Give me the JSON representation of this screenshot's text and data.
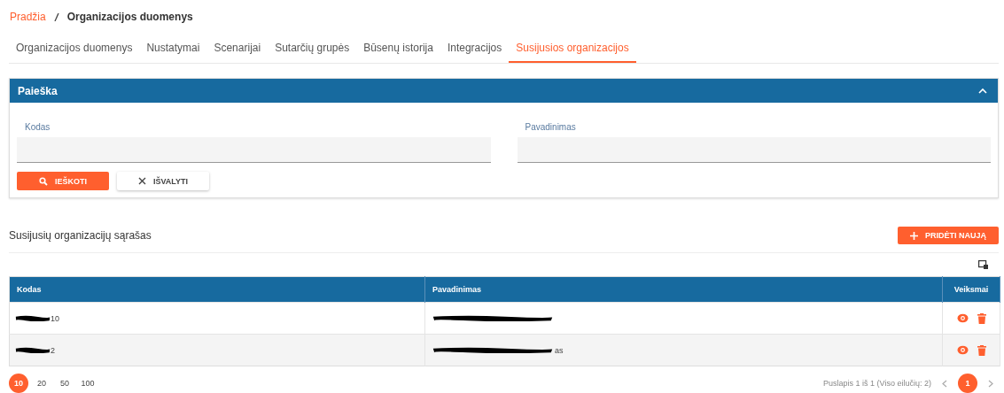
{
  "breadcrumb": [
    {
      "label": "Pradžia",
      "kind": "link"
    },
    {
      "label": "Organizacijos duomenys",
      "kind": "current"
    }
  ],
  "tabs": [
    {
      "label": "Organizacijos duomenys",
      "selected": false
    },
    {
      "label": "Nustatymai",
      "selected": false
    },
    {
      "label": "Scenarijai",
      "selected": false
    },
    {
      "label": "Sutarčių grupės",
      "selected": false
    },
    {
      "label": "Būsenų istorija",
      "selected": false
    },
    {
      "label": "Integracijos",
      "selected": false
    },
    {
      "label": "Susijusios organizacijos",
      "selected": true
    }
  ],
  "search_panel": {
    "title": "Paieška",
    "expanded": true,
    "fields": [
      {
        "label": "Kodas"
      },
      {
        "label": "Pavadinimas"
      }
    ],
    "search_button": "IEŠKOTI",
    "clear_button": "IŠVALYTI"
  },
  "list": {
    "title": "Susijusių organizacijų sąrašas",
    "add_button": "PRIDĖTI NAUJĄ"
  },
  "table": {
    "columns": [
      "Kodas",
      "Pavadinimas",
      "Veiksmai"
    ],
    "rows": [
      {
        "cells": [
          {
            "text": "10",
            "redacted": true
          },
          {
            "redacted": true
          }
        ]
      },
      {
        "cells": [
          {
            "text": "2",
            "redacted": true
          },
          {
            "text": "as",
            "redacted": true
          }
        ]
      }
    ]
  },
  "page_sizes": [
    {
      "label": "10",
      "selected": true
    },
    {
      "label": "20",
      "selected": false
    },
    {
      "label": "50",
      "selected": false
    },
    {
      "label": "100",
      "selected": false
    }
  ],
  "page_info": "Puslapis 1 iš 1 (Viso eilučių: 2)",
  "pages": [
    {
      "label": "1",
      "selected": true
    }
  ]
}
